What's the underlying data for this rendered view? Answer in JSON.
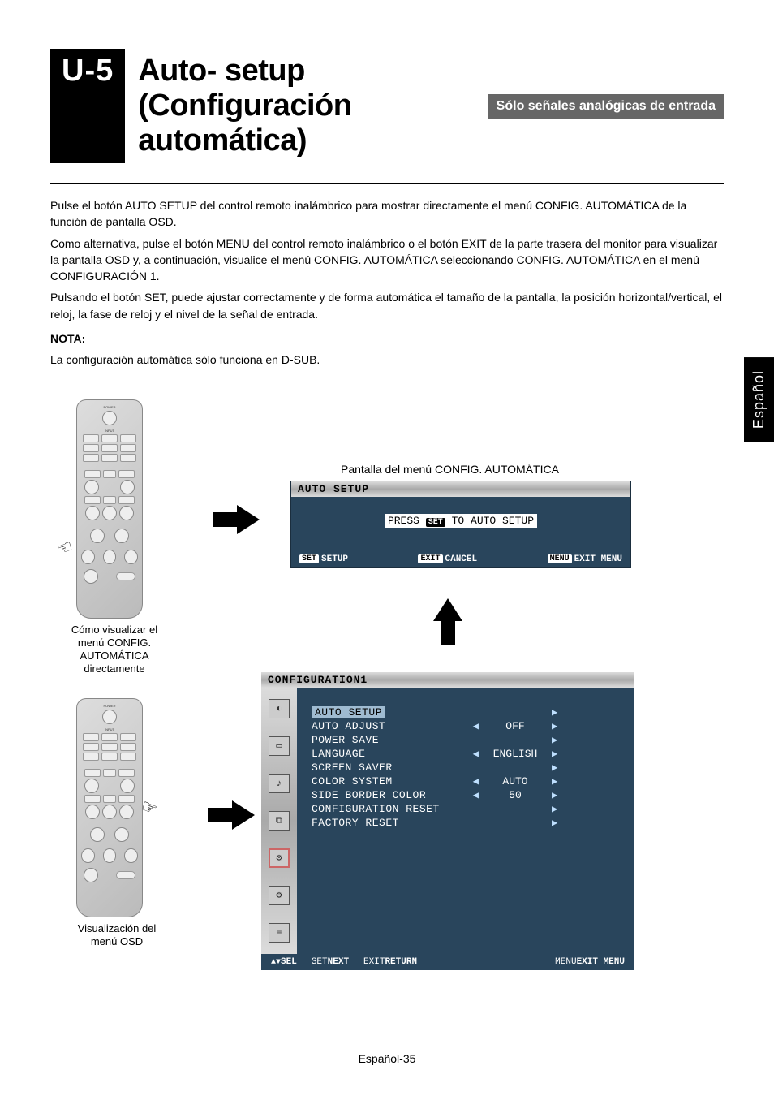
{
  "header": {
    "tag": "U-5",
    "title": "Auto- setup (Configuración automática)",
    "badge": "Sólo señales analógicas de entrada"
  },
  "paragraphs": {
    "p1": "Pulse el botón AUTO SETUP del control remoto inalámbrico para mostrar directamente el menú CONFIG. AUTOMÁTICA de la función de pantalla OSD.",
    "p2": "Como alternativa, pulse el botón MENU del control remoto inalámbrico o el botón EXIT de la parte trasera del monitor para visualizar la pantalla OSD y, a continuación, visualice el menú CONFIG. AUTOMÁTICA seleccionando CONFIG. AUTOMÁTICA en el menú CONFIGURACIÓN 1.",
    "p3": "Pulsando el botón SET, puede ajustar correctamente y de forma automática el tamaño de la pantalla, la posición horizontal/vertical, el reloj, la fase de reloj y el nivel de la señal de entrada.",
    "nota_label": "NOTA:",
    "nota_text": "La configuración automática sólo funciona en D-SUB."
  },
  "captions": {
    "remote1": "Cómo visualizar el menú CONFIG. AUTOMÁTICA directamente",
    "remote2": "Visualización del menú OSD",
    "osd_title_caption": "Pantalla del menú CONFIG. AUTOMÁTICA"
  },
  "osd_auto": {
    "title": "AUTO SETUP",
    "press_pre": "PRESS",
    "press_btn": "SET",
    "press_post": "TO AUTO SETUP",
    "foot_set_lbl": "SET",
    "foot_set_txt": "SETUP",
    "foot_exit_lbl": "EXIT",
    "foot_exit_txt": "CANCEL",
    "foot_menu_lbl": "MENU",
    "foot_menu_txt": "EXIT MENU"
  },
  "osd_config": {
    "title": "CONFIGURATION1",
    "items": [
      {
        "label": "AUTO SETUP",
        "left": false,
        "val": "",
        "right": true,
        "hl": true
      },
      {
        "label": "AUTO ADJUST",
        "left": true,
        "val": "OFF",
        "right": true
      },
      {
        "label": "POWER SAVE",
        "left": false,
        "val": "",
        "right": true
      },
      {
        "label": "LANGUAGE",
        "left": true,
        "val": "ENGLISH",
        "right": true
      },
      {
        "label": "SCREEN SAVER",
        "left": false,
        "val": "",
        "right": true
      },
      {
        "label": "COLOR SYSTEM",
        "left": true,
        "val": "AUTO",
        "right": true
      },
      {
        "label": "SIDE BORDER COLOR",
        "left": true,
        "val": "50",
        "right": true
      },
      {
        "label": "CONFIGURATION RESET",
        "left": false,
        "val": "",
        "right": true
      },
      {
        "label": "FACTORY RESET",
        "left": false,
        "val": "",
        "right": true
      }
    ],
    "foot_sel_tri": "▲▼",
    "foot_sel_txt": "SEL",
    "foot_set_lbl": "SET",
    "foot_set_txt": "NEXT",
    "foot_exit_lbl": "EXIT",
    "foot_exit_txt": "RETURN",
    "foot_menu_lbl": "MENU",
    "foot_menu_txt": "EXIT MENU"
  },
  "sidetab": "Español",
  "footer": "Español-35"
}
